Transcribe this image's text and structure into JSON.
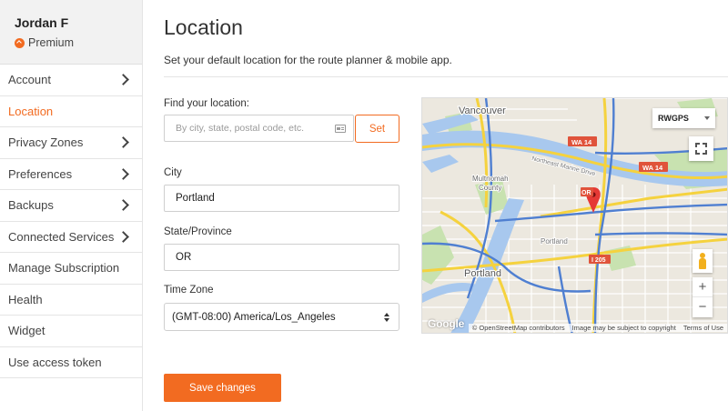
{
  "user": {
    "name": "Jordan F",
    "plan": "Premium"
  },
  "sidebar": {
    "items": [
      {
        "label": "Account",
        "chevron": true
      },
      {
        "label": "Location",
        "active": true
      },
      {
        "label": "Privacy Zones",
        "chevron": true
      },
      {
        "label": "Preferences",
        "chevron": true
      },
      {
        "label": "Backups",
        "chevron": true
      },
      {
        "label": "Connected Services",
        "chevron": true
      },
      {
        "label": "Manage Subscription"
      },
      {
        "label": "Health"
      },
      {
        "label": "Widget"
      },
      {
        "label": "Use access token"
      }
    ]
  },
  "page": {
    "title": "Location",
    "subtitle": "Set your default location for the route planner & mobile app."
  },
  "form": {
    "find_label": "Find your location:",
    "find_placeholder": "By city, state, postal code, etc.",
    "set_label": "Set",
    "city_label": "City",
    "city_value": "Portland",
    "state_label": "State/Province",
    "state_value": "OR",
    "timezone_label": "Time Zone",
    "timezone_value": "(GMT-08:00) America/Los_Angeles",
    "save_label": "Save changes"
  },
  "map": {
    "type_label": "RWGPS",
    "labels": {
      "vancouver": "Vancouver",
      "portland": "Portland",
      "portland_small": "Portland",
      "multnomah": "Multnomah",
      "county": "County",
      "wa14a": "WA 14",
      "wa14b": "WA 14",
      "i205": "I 205",
      "or": "OR",
      "ne_marine": "Northeast Marine Drive"
    },
    "google": "Google",
    "attribution": "© OpenStreetMap contributors",
    "disclaimer": "Image may be subject to copyright",
    "terms": "Terms of Use",
    "zoom_in": "+",
    "zoom_out": "−",
    "colors": {
      "water": "#a8c8ee",
      "land": "#ece8df",
      "park": "#c8e2b0",
      "highway": "#f5d23e",
      "road": "#ffffff",
      "marker": "#e53935",
      "route": "#4f7fd1"
    }
  },
  "colors": {
    "accent": "#f26b21"
  }
}
